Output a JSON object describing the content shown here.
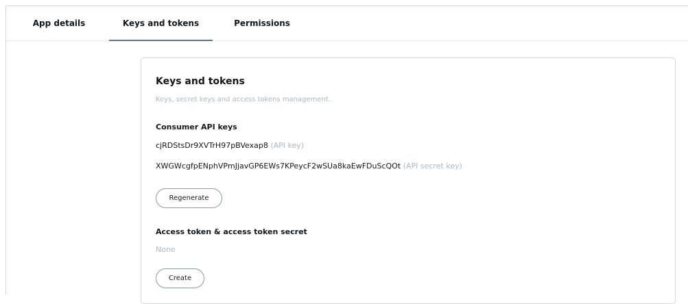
{
  "tabs": [
    {
      "label": "App details",
      "active": false
    },
    {
      "label": "Keys and tokens",
      "active": true
    },
    {
      "label": "Permissions",
      "active": false
    }
  ],
  "card": {
    "title": "Keys and tokens",
    "subtitle": "Keys, secret keys and access tokens management.",
    "consumer": {
      "heading": "Consumer API keys",
      "api_key": "cjRDStsDr9XVTrH97pBVexap8",
      "api_key_tag": "(API key)",
      "api_secret": "XWGWcgfpENphVPmJjavGP6EWs7KPeycF2wSUa8kaEwFDuScQOt",
      "api_secret_tag": "(API secret key)",
      "regenerate_label": "Regenerate"
    },
    "access": {
      "heading": "Access token & access token secret",
      "value": "None",
      "create_label": "Create"
    }
  },
  "colors": {
    "active_tab_underline": "#657786",
    "muted_text": "#aab8c2"
  }
}
